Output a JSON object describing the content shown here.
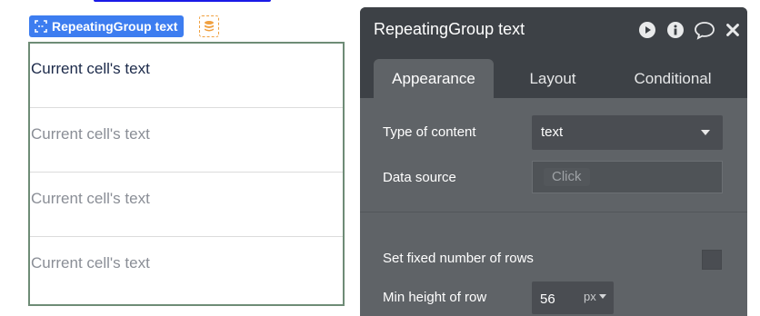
{
  "element_tag": {
    "label": "RepeatingGroup text",
    "icon": "repeating-group-icon",
    "color": "#3d7df0"
  },
  "database_button": {
    "icon": "database-icon"
  },
  "repeating_group": {
    "cells": [
      {
        "text": "Current cell's text"
      },
      {
        "text": "Current cell's text"
      },
      {
        "text": "Current cell's text"
      },
      {
        "text": "Current cell's text"
      }
    ]
  },
  "panel": {
    "title": "RepeatingGroup text",
    "header_icons": [
      "preview-icon",
      "info-icon",
      "comment-icon",
      "close-icon"
    ],
    "tabs": [
      {
        "label": "Appearance",
        "active": true
      },
      {
        "label": "Layout",
        "active": false
      },
      {
        "label": "Conditional",
        "active": false
      }
    ],
    "type_of_content": {
      "label": "Type of content",
      "value": "text"
    },
    "data_source": {
      "label": "Data source",
      "button": "Click"
    },
    "fixed_rows": {
      "label": "Set fixed number of rows",
      "checked": false
    },
    "min_height": {
      "label": "Min height of row",
      "value": "56",
      "unit": "px"
    }
  }
}
